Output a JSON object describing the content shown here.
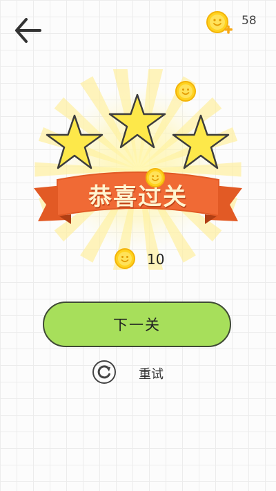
{
  "header": {
    "back_icon": "back-arrow-icon",
    "coin_icon": "coin-plus-icon",
    "coin_count": "58"
  },
  "result": {
    "stars_earned": 3,
    "stars_total": 3,
    "title": "恭喜过关",
    "reward_icon": "coin-icon",
    "reward_amount": "10"
  },
  "actions": {
    "next_label": "下一关",
    "retry_label": "重试",
    "retry_icon": "retry-icon"
  },
  "colors": {
    "star": "#fde84a",
    "coin": "#ffd21f",
    "ribbon": "#f06a35",
    "button": "#a7df5b"
  }
}
